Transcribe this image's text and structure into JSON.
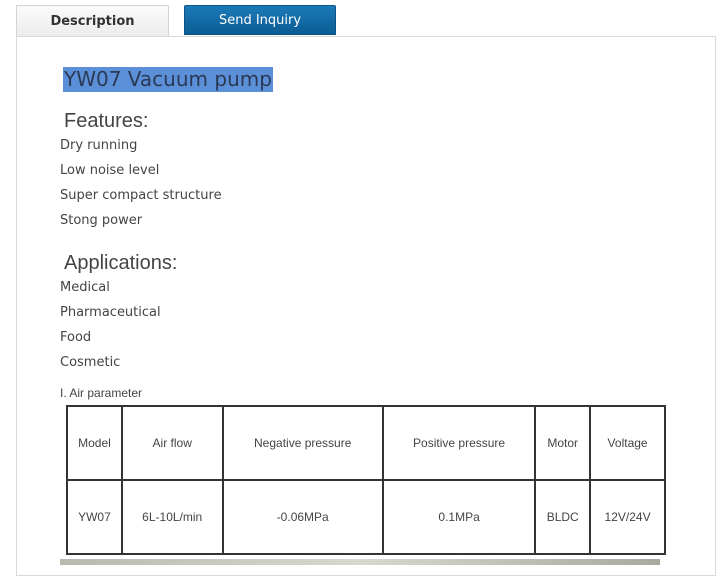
{
  "tabs": {
    "description": "Description",
    "inquiry": "Send Inquiry"
  },
  "product": {
    "title": "YW07 Vacuum pump"
  },
  "features": {
    "heading": "Features:",
    "items": [
      "Dry running",
      "Low noise level",
      "Super compact structure",
      "Stong power"
    ]
  },
  "applications": {
    "heading": "Applications:",
    "items": [
      "Medical",
      "Pharmaceutical",
      "Food",
      "Cosmetic"
    ]
  },
  "air_parameter": {
    "label": "I. Air parameter",
    "headers": [
      "Model",
      "Air flow",
      "Negative pressure",
      "Positive pressure",
      "Motor",
      "Voltage"
    ],
    "rows": [
      [
        "YW07",
        "6L-10L/min",
        "-0.06MPa",
        "0.1MPa",
        "BLDC",
        "12V/24V"
      ]
    ]
  },
  "colors": {
    "inquiry_tab": "#0b5c93",
    "title_highlight": "#5b8fd8"
  }
}
